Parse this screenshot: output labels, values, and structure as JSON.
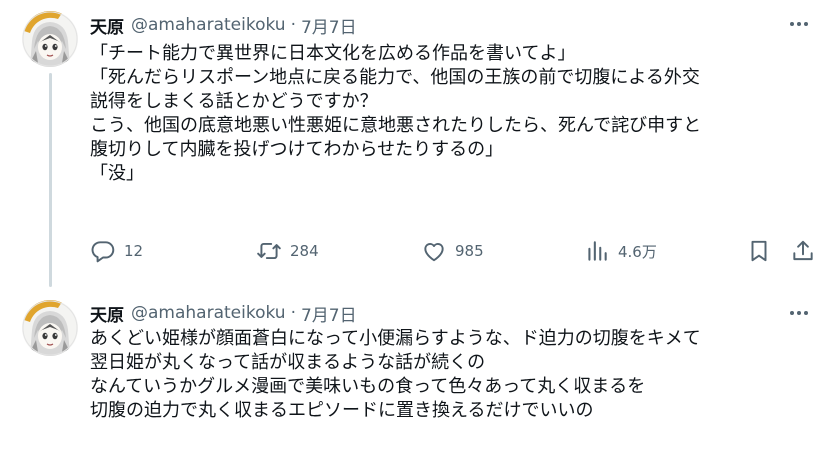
{
  "tweets": [
    {
      "display_name": "天原",
      "handle": "@amaharateikoku",
      "separator": "·",
      "date": "7月7日",
      "avatar_icon": "anime-avatar-icon",
      "lines": [
        "「チート能力で異世界に日本文化を広める作品を書いてよ」",
        "「死んだらリスポーン地点に戻る能力で、他国の王族の前で切腹による外交",
        "説得をしまくる話とかどうですか？",
        "こう、他国の底意地悪い性悪姫に意地悪されたりしたら、死んで詫び申すと",
        "腹切りして内臓を投げつけてわからせたりするの」",
        "「没」"
      ],
      "actions": {
        "reply": "12",
        "retweet": "284",
        "like": "985",
        "views": "4.6万"
      }
    },
    {
      "display_name": "天原",
      "handle": "@amaharateikoku",
      "separator": "·",
      "date": "7月7日",
      "avatar_icon": "anime-avatar-icon",
      "lines": [
        "あくどい姫様が顔面蒼白になって小便漏らすような、ド迫力の切腹をキメて",
        "翌日姫が丸くなって話が収まるような話が続くの",
        "なんていうかグルメ漫画で美味いもの食って色々あって丸く収まるを",
        "切腹の迫力で丸く収まるエピソードに置き換えるだけでいいの"
      ]
    }
  ],
  "icons": {
    "more": "more-icon",
    "reply": "reply-icon",
    "retweet": "retweet-icon",
    "like": "heart-icon",
    "views": "views-icon",
    "bookmark": "bookmark-icon",
    "share": "share-icon"
  },
  "colors": {
    "text": "#0f1419",
    "secondary": "#536471",
    "thread_line": "#cfd9de",
    "avatar_ring": "#e0a52e"
  }
}
